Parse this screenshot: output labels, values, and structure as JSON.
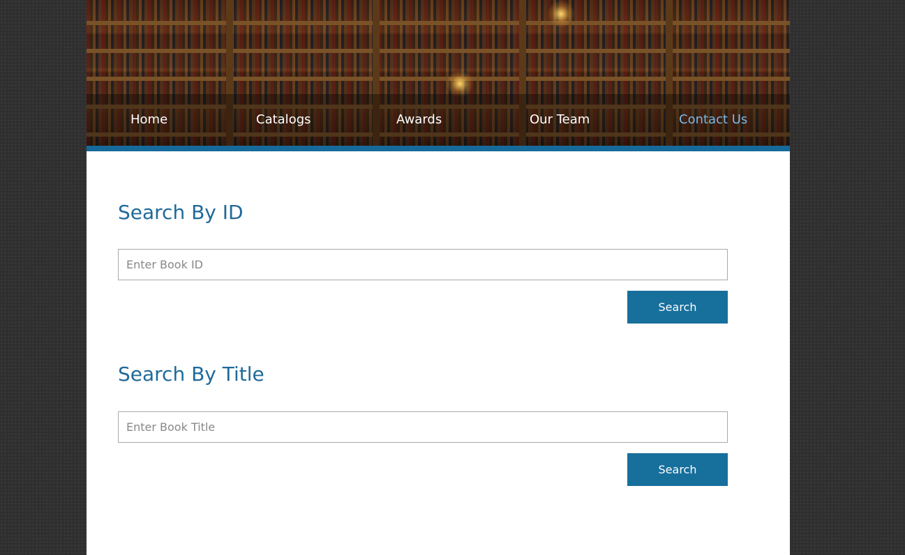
{
  "nav": {
    "items": [
      {
        "label": "Home"
      },
      {
        "label": "Catalogs"
      },
      {
        "label": "Awards"
      },
      {
        "label": "Our Team"
      },
      {
        "label": "Contact Us"
      }
    ]
  },
  "search_id": {
    "title": "Search By ID",
    "placeholder": "Enter Book ID",
    "button": "Search"
  },
  "search_title": {
    "title": "Search By Title",
    "placeholder": "Enter Book Title",
    "button": "Search"
  }
}
